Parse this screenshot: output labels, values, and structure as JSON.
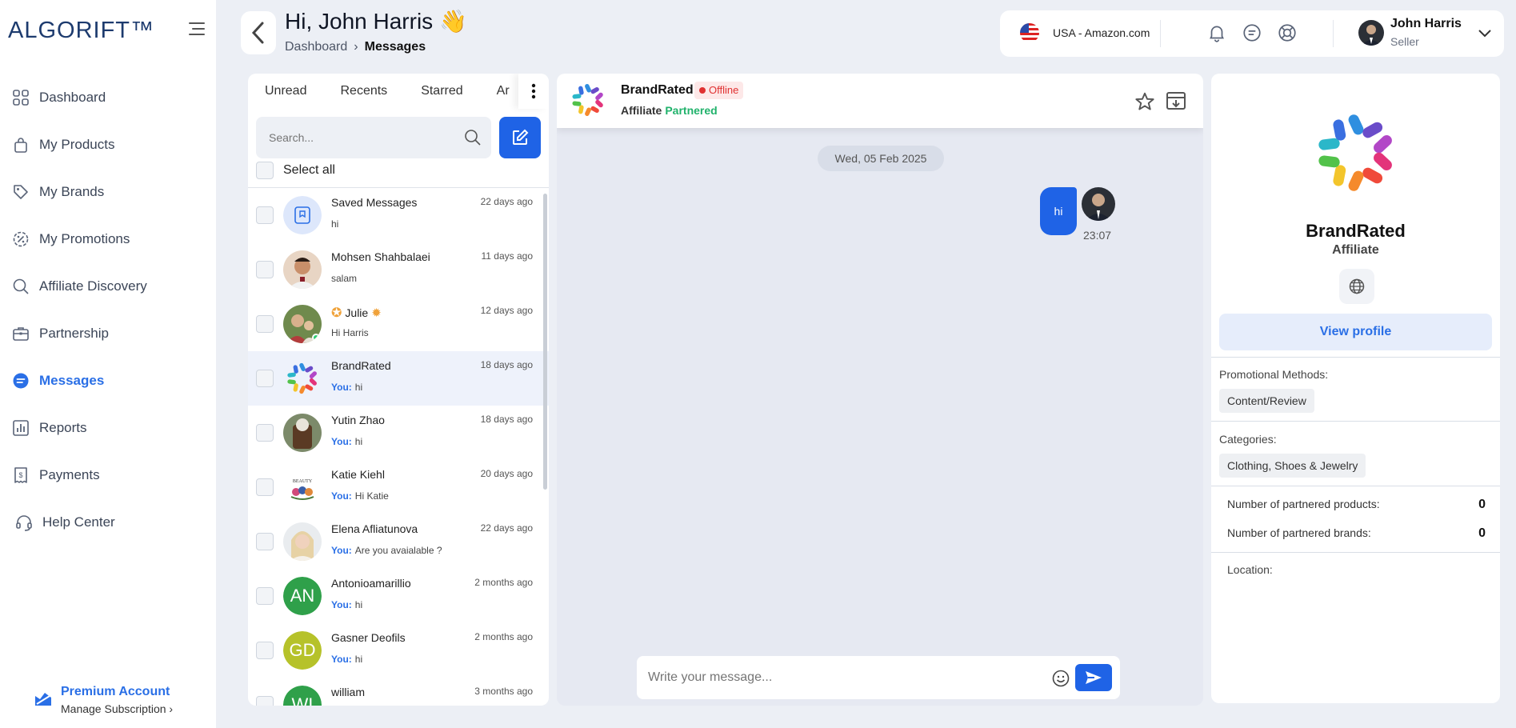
{
  "sidebar": {
    "logo": "ALGORIFT™",
    "items": [
      {
        "label": "Dashboard",
        "icon": "grid-icon"
      },
      {
        "label": "My Products",
        "icon": "bag-icon"
      },
      {
        "label": "My Brands",
        "icon": "tag-icon"
      },
      {
        "label": "My Promotions",
        "icon": "discount-icon"
      },
      {
        "label": "Affiliate Discovery",
        "icon": "search-icon"
      },
      {
        "label": "Partnership",
        "icon": "briefcase-icon"
      },
      {
        "label": "Messages",
        "icon": "chat-icon",
        "active": true
      },
      {
        "label": "Reports",
        "icon": "bar-chart-icon"
      },
      {
        "label": "Payments",
        "icon": "receipt-icon"
      },
      {
        "label": "Help Center",
        "icon": "headset-icon"
      }
    ],
    "premium": {
      "title": "Premium Account",
      "link": "Manage Subscription"
    }
  },
  "header": {
    "greeting": "Hi, John Harris",
    "breadcrumb": [
      "Dashboard",
      "Messages"
    ]
  },
  "topbar": {
    "market": "USA - Amazon.com",
    "user_name": "John Harris",
    "user_role": "Seller"
  },
  "list": {
    "tabs": [
      "Unread",
      "Recents",
      "Starred",
      "Ar"
    ],
    "search_placeholder": "Search...",
    "select_all": "Select all",
    "you_label": "You:",
    "conversations": [
      {
        "name": "Saved Messages",
        "time": "22 days ago",
        "preview": "hi",
        "you": false,
        "avatar": "saved"
      },
      {
        "name": "Mohsen Shahbalaei",
        "time": "11 days ago",
        "preview": "salam",
        "you": false,
        "avatar": "photo-a"
      },
      {
        "name": "Julie",
        "time": "12 days ago",
        "preview": "Hi Harris",
        "you": false,
        "avatar": "photo-b",
        "online": true
      },
      {
        "name": "BrandRated",
        "time": "18 days ago",
        "preview": "hi",
        "you": true,
        "avatar": "brand",
        "selected": true
      },
      {
        "name": "Yutin Zhao",
        "time": "18 days ago",
        "preview": "hi",
        "you": true,
        "avatar": "photo-c"
      },
      {
        "name": "Katie Kiehl",
        "time": "20 days ago",
        "preview": "Hi Katie",
        "you": true,
        "avatar": "photo-d"
      },
      {
        "name": "Elena Afliatunova",
        "time": "22 days ago",
        "preview": "Are you avaialable ?",
        "you": true,
        "avatar": "photo-e"
      },
      {
        "name": "Antonioamarillio",
        "time": "2 months ago",
        "preview": "hi",
        "you": true,
        "avatar": "initials",
        "initials": "AN",
        "color": "#2fa04a"
      },
      {
        "name": "Gasner Deofils",
        "time": "2 months ago",
        "preview": "hi",
        "you": true,
        "avatar": "initials",
        "initials": "GD",
        "color": "#b6c22a"
      },
      {
        "name": "william",
        "time": "3 months ago",
        "preview": "",
        "you": false,
        "avatar": "initials",
        "initials": "WI",
        "color": "#2fa04a"
      }
    ]
  },
  "chat": {
    "name": "BrandRated",
    "status": "Offline",
    "type": "Affiliate",
    "partner_status": "Partnered",
    "date": "Wed, 05 Feb 2025",
    "message": {
      "text": "hi",
      "time": "23:07"
    },
    "input_placeholder": "Write your message..."
  },
  "profile": {
    "name": "BrandRated",
    "type": "Affiliate",
    "view_profile": "View profile",
    "promo_label": "Promotional Methods:",
    "promo_value": "Content/Review",
    "cat_label": "Categories:",
    "cat_value": "Clothing, Shoes & Jewelry",
    "products_label": "Number of partnered products:",
    "products_value": "0",
    "brands_label": "Number of partnered brands:",
    "brands_value": "0",
    "location_label": "Location:"
  },
  "colors": {
    "accent": "#1f63e6",
    "success": "#20b26b",
    "danger": "#e03131",
    "background": "#ECEFF5"
  }
}
